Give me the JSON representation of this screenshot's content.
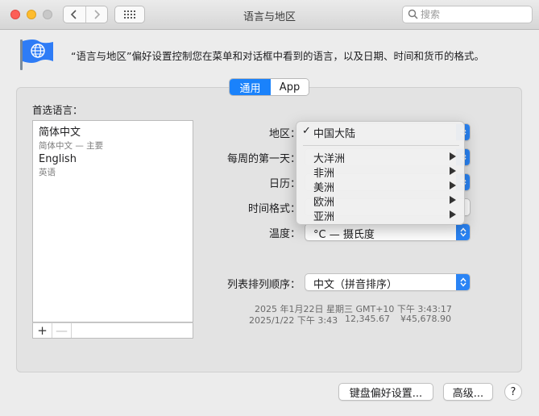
{
  "window": {
    "title": "语言与地区",
    "search_placeholder": "搜索"
  },
  "header": {
    "description": "“语言与地区”偏好设置控制您在菜单和对话框中看到的语言，以及日期、时间和货币的格式。"
  },
  "tabs": [
    {
      "label": "通用",
      "active": true
    },
    {
      "label": "App",
      "active": false
    }
  ],
  "preferred_languages": {
    "label": "首选语言：",
    "items": [
      {
        "name": "简体中文",
        "sub": "简体中文 — 主要"
      },
      {
        "name": "English",
        "sub": "英语"
      }
    ],
    "add": "+",
    "remove": "—"
  },
  "form": {
    "region_label": "地区：",
    "week_label": "每周的第一天：",
    "calendar_label": "日历：",
    "timefmt_label": "时间格式：",
    "temperature_label": "温度：",
    "temperature_value": "°C — 摄氏度",
    "sort_label": "列表排列顺序：",
    "sort_value": "中文（拼音排序）"
  },
  "region_menu": {
    "selected": "中国大陆",
    "check": "✓",
    "items": [
      "大洋洲",
      "非洲",
      "美洲",
      "欧洲",
      "亚洲"
    ]
  },
  "preview": {
    "line1": "2025 年1月22日 星期三 GMT+10 下午 3:43:17",
    "line2_date": "2025/1/22 下午 3:43",
    "line2_number": "12,345.67",
    "line2_currency": "¥45,678.90"
  },
  "buttons": {
    "keyboard": "键盘偏好设置...",
    "advanced": "高级...",
    "help": "?"
  },
  "colors": {
    "accent": "#1a82fb"
  }
}
